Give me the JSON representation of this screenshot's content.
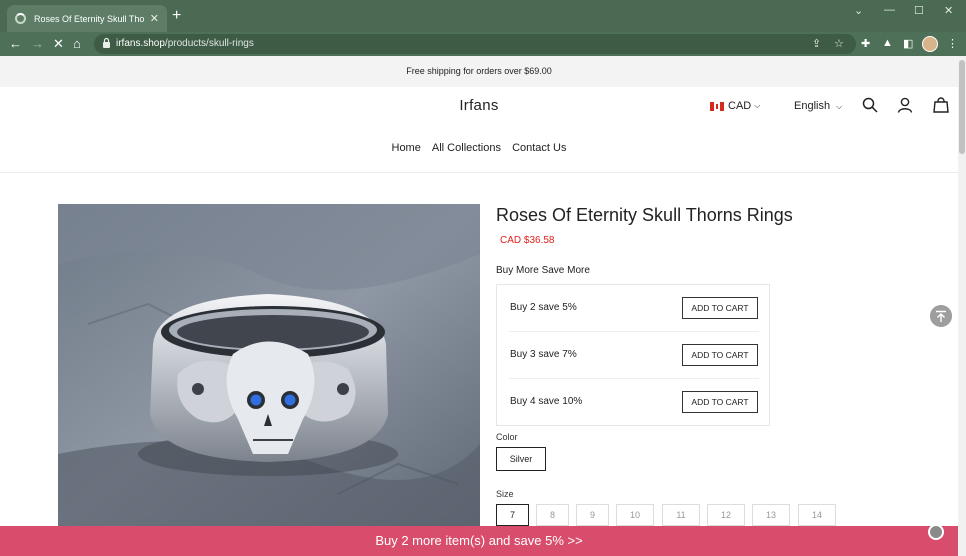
{
  "browser": {
    "tab_title": "Roses Of Eternity Skull Thorns Rings",
    "url_host": "irfans.shop",
    "url_path": "/products/skull-rings"
  },
  "store": {
    "announcement": "Free shipping for orders over $69.00",
    "brand": "Irfans",
    "currency": "CAD",
    "language": "English",
    "nav": [
      "Home",
      "All Collections",
      "Contact Us"
    ]
  },
  "product": {
    "title": "Roses Of Eternity Skull Thorns Rings",
    "price": "CAD $36.58",
    "bundle_heading": "Buy More Save More",
    "offers": [
      {
        "label": "Buy 2 save 5%",
        "button": "ADD TO CART"
      },
      {
        "label": "Buy 3 save 7%",
        "button": "ADD TO CART"
      },
      {
        "label": "Buy 4 save 10%",
        "button": "ADD TO CART"
      }
    ],
    "color_label": "Color",
    "color_selected": "Silver",
    "size_label": "Size",
    "sizes": [
      "7",
      "8",
      "9",
      "10",
      "11",
      "12",
      "13",
      "14"
    ],
    "size_selected": "7"
  },
  "promo_bar": "Buy 2 more item(s) and save 5%  >>",
  "colors": {
    "chrome_tab_bar": "#4a6a54",
    "price": "#e0201c",
    "promo_bar": "#d94d6c"
  }
}
